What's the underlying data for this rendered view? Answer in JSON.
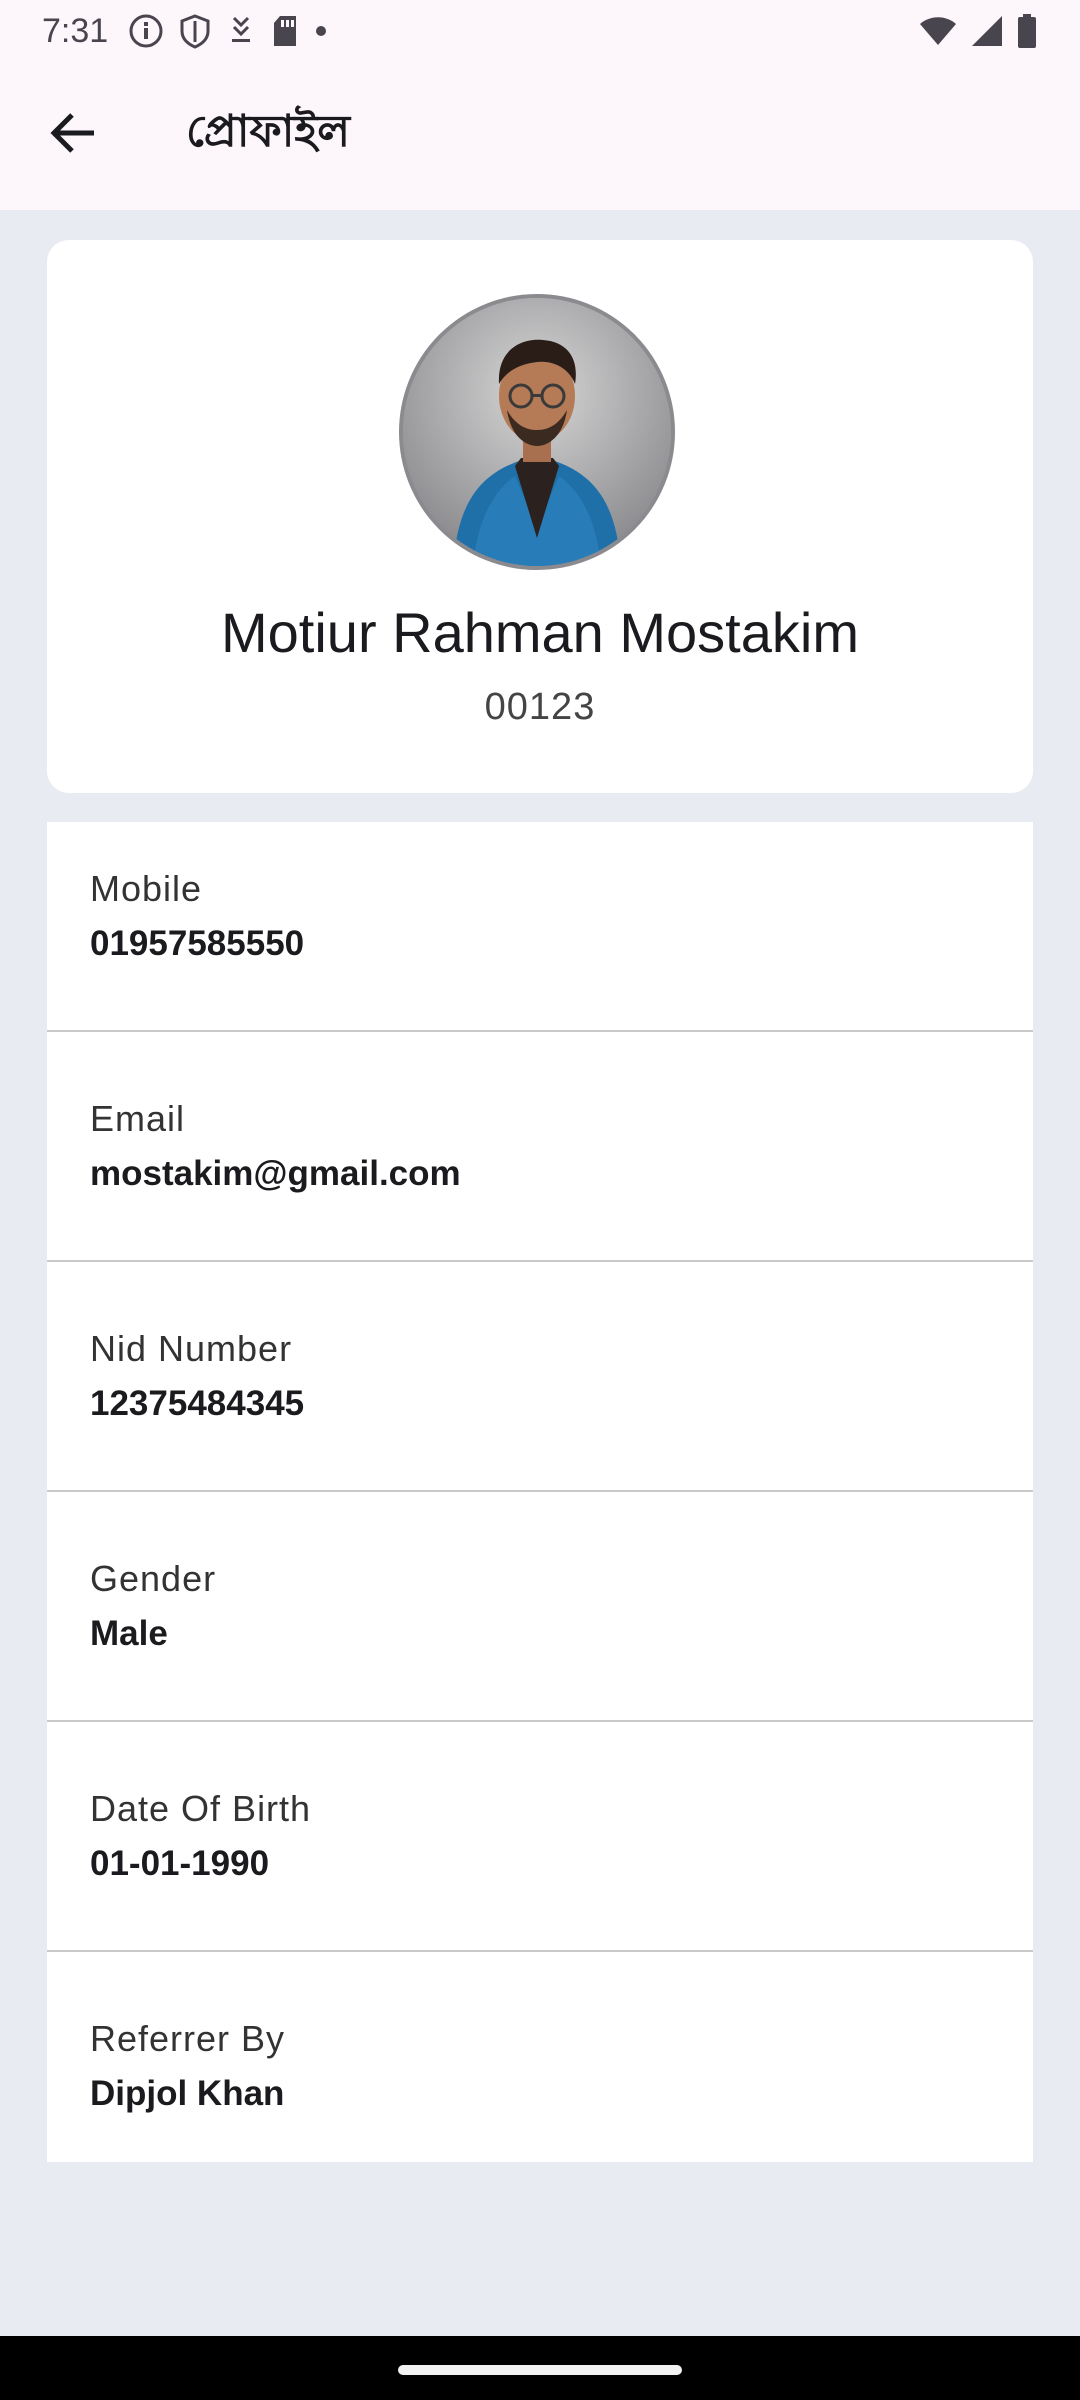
{
  "status_bar": {
    "time": "7:31",
    "icons_left": [
      "info-icon",
      "shield-icon",
      "download-icon",
      "sd-card-icon",
      "dot-icon"
    ],
    "icons_right": [
      "wifi-icon",
      "signal-icon",
      "battery-icon"
    ]
  },
  "app_bar": {
    "back_icon": "arrow-left-icon",
    "title": "প্রোফাইল"
  },
  "profile": {
    "name": "Motiur Rahman Mostakim",
    "id": "00123"
  },
  "details": [
    {
      "label": "Mobile",
      "value": "01957585550"
    },
    {
      "label": "Email",
      "value": "mostakim@gmail.com"
    },
    {
      "label": "Nid Number",
      "value": "12375484345"
    },
    {
      "label": "Gender",
      "value": "Male"
    },
    {
      "label": "Date Of Birth",
      "value": "01-01-1990"
    },
    {
      "label": "Referrer By",
      "value": "Dipjol Khan"
    }
  ],
  "colors": {
    "background": "#e9ebf2",
    "app_bar": "#fdf7fb",
    "card": "#ffffff",
    "accent_blazer": "#1f6fa8"
  }
}
